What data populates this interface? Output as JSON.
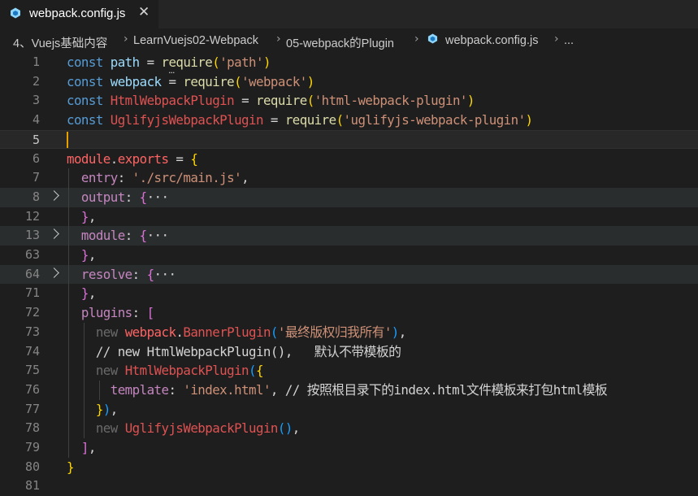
{
  "tab": {
    "title": "webpack.config.js",
    "icon": "webpack-icon",
    "close_icon": "close-icon"
  },
  "breadcrumb": {
    "items": [
      "4、Vuejs基础内容",
      "LearnVuejs02-Webpack",
      "05-webpack的Plugin",
      "webpack.config.js",
      "..."
    ]
  },
  "editor": {
    "hover_indicator": "...",
    "lines": [
      {
        "n": "1",
        "tokens": [
          [
            "kw",
            "const "
          ],
          [
            "id",
            "path"
          ],
          [
            "op",
            " = "
          ],
          [
            "fn",
            "require"
          ],
          [
            "br",
            "("
          ],
          [
            "str",
            "'path'"
          ],
          [
            "br",
            ")"
          ]
        ]
      },
      {
        "n": "2",
        "tokens": [
          [
            "kw",
            "const "
          ],
          [
            "id",
            "webpack"
          ],
          [
            "op",
            " = "
          ],
          [
            "fn",
            "require"
          ],
          [
            "br",
            "("
          ],
          [
            "str",
            "'webpack'"
          ],
          [
            "br",
            ")"
          ]
        ]
      },
      {
        "n": "3",
        "tokens": [
          [
            "kw",
            "const "
          ],
          [
            "cls",
            "HtmlWebpackPlugin"
          ],
          [
            "op",
            " = "
          ],
          [
            "fn",
            "require"
          ],
          [
            "br",
            "("
          ],
          [
            "str",
            "'html-webpack-plugin'"
          ],
          [
            "br",
            ")"
          ]
        ]
      },
      {
        "n": "4",
        "tokens": [
          [
            "kw",
            "const "
          ],
          [
            "cls",
            "UglifyjsWebpackPlugin"
          ],
          [
            "op",
            " = "
          ],
          [
            "fn",
            "require"
          ],
          [
            "br",
            "("
          ],
          [
            "str",
            "'uglifyjs-webpack-plugin'"
          ],
          [
            "br",
            ")"
          ]
        ]
      },
      {
        "n": "5",
        "tokens": []
      },
      {
        "n": "6",
        "tokens": [
          [
            "mod",
            "module"
          ],
          [
            "op",
            "."
          ],
          [
            "mod",
            "exports"
          ],
          [
            "op",
            " = "
          ],
          [
            "br",
            "{"
          ]
        ]
      },
      {
        "n": "7",
        "tokens": [
          [
            "op",
            "  "
          ],
          [
            "prop",
            "entry"
          ],
          [
            "op",
            ": "
          ],
          [
            "str",
            "'./src/main.js'"
          ],
          [
            "op",
            ","
          ]
        ]
      },
      {
        "n": "8",
        "tokens": [
          [
            "op",
            "  "
          ],
          [
            "prop",
            "output"
          ],
          [
            "op",
            ": "
          ],
          [
            "br2",
            "{"
          ],
          [
            "op",
            "···"
          ]
        ]
      },
      {
        "n": "12",
        "tokens": [
          [
            "op",
            "  "
          ],
          [
            "br2",
            "}"
          ],
          [
            "op",
            ","
          ]
        ]
      },
      {
        "n": "13",
        "tokens": [
          [
            "op",
            "  "
          ],
          [
            "prop",
            "module"
          ],
          [
            "op",
            ": "
          ],
          [
            "br2",
            "{"
          ],
          [
            "op",
            "···"
          ]
        ]
      },
      {
        "n": "63",
        "tokens": [
          [
            "op",
            "  "
          ],
          [
            "br2",
            "}"
          ],
          [
            "op",
            ","
          ]
        ]
      },
      {
        "n": "64",
        "tokens": [
          [
            "op",
            "  "
          ],
          [
            "prop",
            "resolve"
          ],
          [
            "op",
            ": "
          ],
          [
            "br2",
            "{"
          ],
          [
            "op",
            "···"
          ]
        ]
      },
      {
        "n": "71",
        "tokens": [
          [
            "op",
            "  "
          ],
          [
            "br2",
            "}"
          ],
          [
            "op",
            ","
          ]
        ]
      },
      {
        "n": "72",
        "tokens": [
          [
            "op",
            "  "
          ],
          [
            "prop",
            "plugins"
          ],
          [
            "op",
            ": "
          ],
          [
            "br2",
            "["
          ]
        ]
      },
      {
        "n": "73",
        "tokens": [
          [
            "op",
            "    "
          ],
          [
            "dim",
            "new "
          ],
          [
            "mod",
            "webpack"
          ],
          [
            "op",
            "."
          ],
          [
            "cls",
            "BannerPlugin"
          ],
          [
            "br3",
            "("
          ],
          [
            "str",
            "'最终版权归我所有'"
          ],
          [
            "br3",
            ")"
          ],
          [
            "op",
            ","
          ]
        ]
      },
      {
        "n": "74",
        "tokens": [
          [
            "op",
            "    "
          ],
          [
            "cm",
            "// new HtmlWebpackPlugin(),   默认不带模板的"
          ]
        ]
      },
      {
        "n": "75",
        "tokens": [
          [
            "op",
            "    "
          ],
          [
            "dim",
            "new "
          ],
          [
            "cls",
            "HtmlWebpackPlugin"
          ],
          [
            "br3",
            "("
          ],
          [
            "br",
            "{"
          ]
        ]
      },
      {
        "n": "76",
        "tokens": [
          [
            "op",
            "      "
          ],
          [
            "prop",
            "template"
          ],
          [
            "op",
            ": "
          ],
          [
            "str",
            "'index.html'"
          ],
          [
            "op",
            ", "
          ],
          [
            "cm",
            "// 按照根目录下的index.html文件模板来打包html模板"
          ]
        ]
      },
      {
        "n": "77",
        "tokens": [
          [
            "op",
            "    "
          ],
          [
            "br",
            "}"
          ],
          [
            "br3",
            ")"
          ],
          [
            "op",
            ","
          ]
        ]
      },
      {
        "n": "78",
        "tokens": [
          [
            "op",
            "    "
          ],
          [
            "dim",
            "new "
          ],
          [
            "cls",
            "UglifyjsWebpackPlugin"
          ],
          [
            "br3",
            "()"
          ],
          [
            "op",
            ","
          ]
        ]
      },
      {
        "n": "79",
        "tokens": [
          [
            "op",
            "  "
          ],
          [
            "br2",
            "]"
          ],
          [
            "op",
            ","
          ]
        ]
      },
      {
        "n": "80",
        "tokens": [
          [
            "br",
            "}"
          ]
        ]
      },
      {
        "n": "81",
        "tokens": []
      }
    ]
  },
  "colors": {
    "background": "#1e1e1e",
    "keyword": "#569cd6",
    "string": "#ce9178",
    "function": "#dcdcaa",
    "class": "#e05252",
    "property": "#c586c0",
    "cursor": "#e8a000"
  }
}
